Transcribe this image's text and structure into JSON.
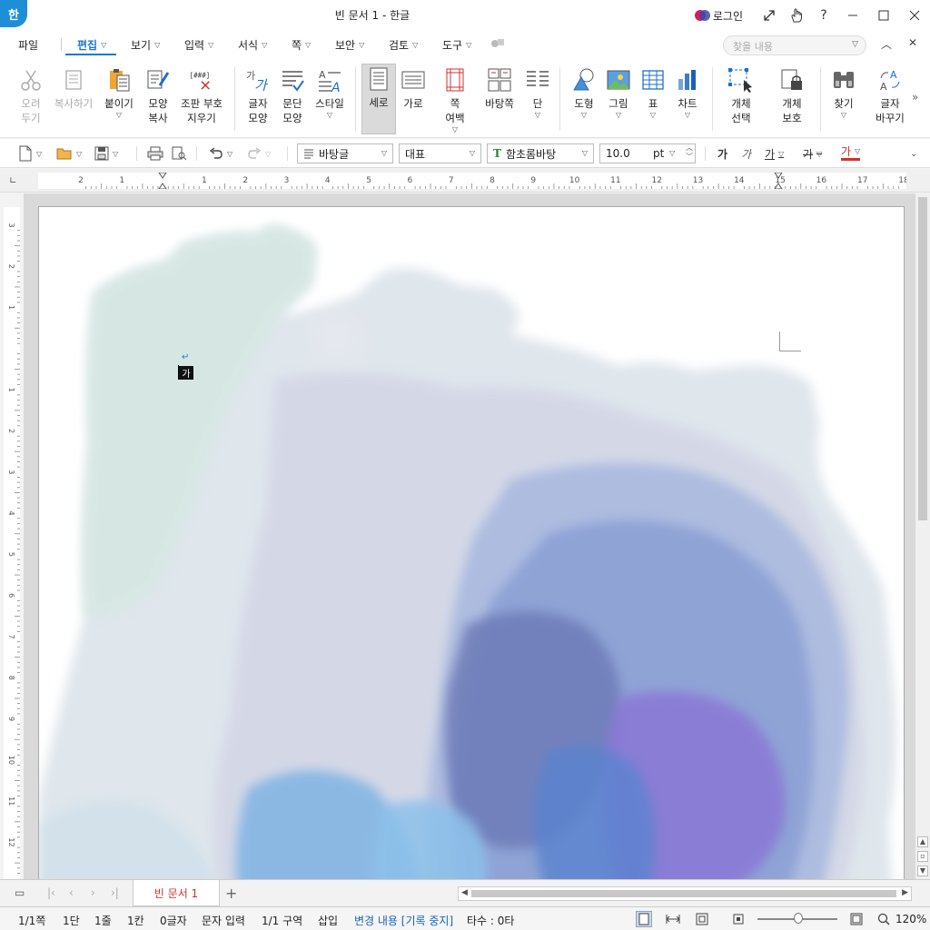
{
  "window": {
    "title": "빈 문서 1 - 한글",
    "logo": "한",
    "login_label": "로그인",
    "icons": [
      "expand-icon",
      "hand-icon",
      "help-icon"
    ]
  },
  "menu": {
    "file": "파일",
    "items": [
      {
        "label": "편집",
        "active": true
      },
      {
        "label": "보기"
      },
      {
        "label": "입력"
      },
      {
        "label": "서식"
      },
      {
        "label": "쪽"
      },
      {
        "label": "보안"
      },
      {
        "label": "검토"
      },
      {
        "label": "도구"
      }
    ],
    "search_placeholder": "찾을 내용"
  },
  "ribbon": {
    "cut": "오려\n두기",
    "copy": "복사하기",
    "paste": "붙이기",
    "format_copy": "모양\n복사",
    "clear_codes": "조판 부호\n지우기",
    "char_shape": "글자\n모양",
    "para_shape": "문단\n모양",
    "style": "스타일",
    "portrait": "세로",
    "landscape": "가로",
    "page_margin": "쪽\n여백",
    "background_page": "바탕쪽",
    "columns": "단",
    "shape": "도형",
    "picture": "그림",
    "table": "표",
    "chart": "차트",
    "select_object": "개체\n선택",
    "protect_object": "개체\n보호",
    "find": "찾기",
    "replace": "글자\n바꾸기",
    "clear_codes_icon_text": "[###]"
  },
  "format": {
    "style_value": "바탕글",
    "language_value": "대표",
    "font_value": "함초롬바탕",
    "size_value": "10.0",
    "size_unit": "pt",
    "char_glyph": "가"
  },
  "ruler": {
    "h_ticks": [
      "2",
      "1",
      "",
      "1",
      "2",
      "3",
      "4",
      "5",
      "6",
      "7",
      "8",
      "9",
      "10",
      "11",
      "12",
      "13",
      "14",
      "15",
      "16",
      "17",
      "18"
    ],
    "v_ticks": [
      "3",
      "2",
      "1",
      "",
      "1",
      "2",
      "3",
      "4",
      "5",
      "6",
      "7",
      "8",
      "9",
      "10",
      "11",
      "12"
    ]
  },
  "document": {
    "ime_char": "가",
    "para_mark": "↵"
  },
  "tabs": {
    "doc_tab": "빈 문서 1",
    "add": "+"
  },
  "status": {
    "page": "1/1쪽",
    "column": "1단",
    "line": "1줄",
    "col": "1칸",
    "chars": "0글자",
    "mode": "문자 입력",
    "section": "1/1 구역",
    "insert": "삽입",
    "track_changes": "변경 내용 [기록 중지]",
    "typing": "타수 : 0타",
    "zoom": "120%"
  },
  "colors": {
    "accent": "#1976d2",
    "tab_text": "#d32f2f"
  }
}
